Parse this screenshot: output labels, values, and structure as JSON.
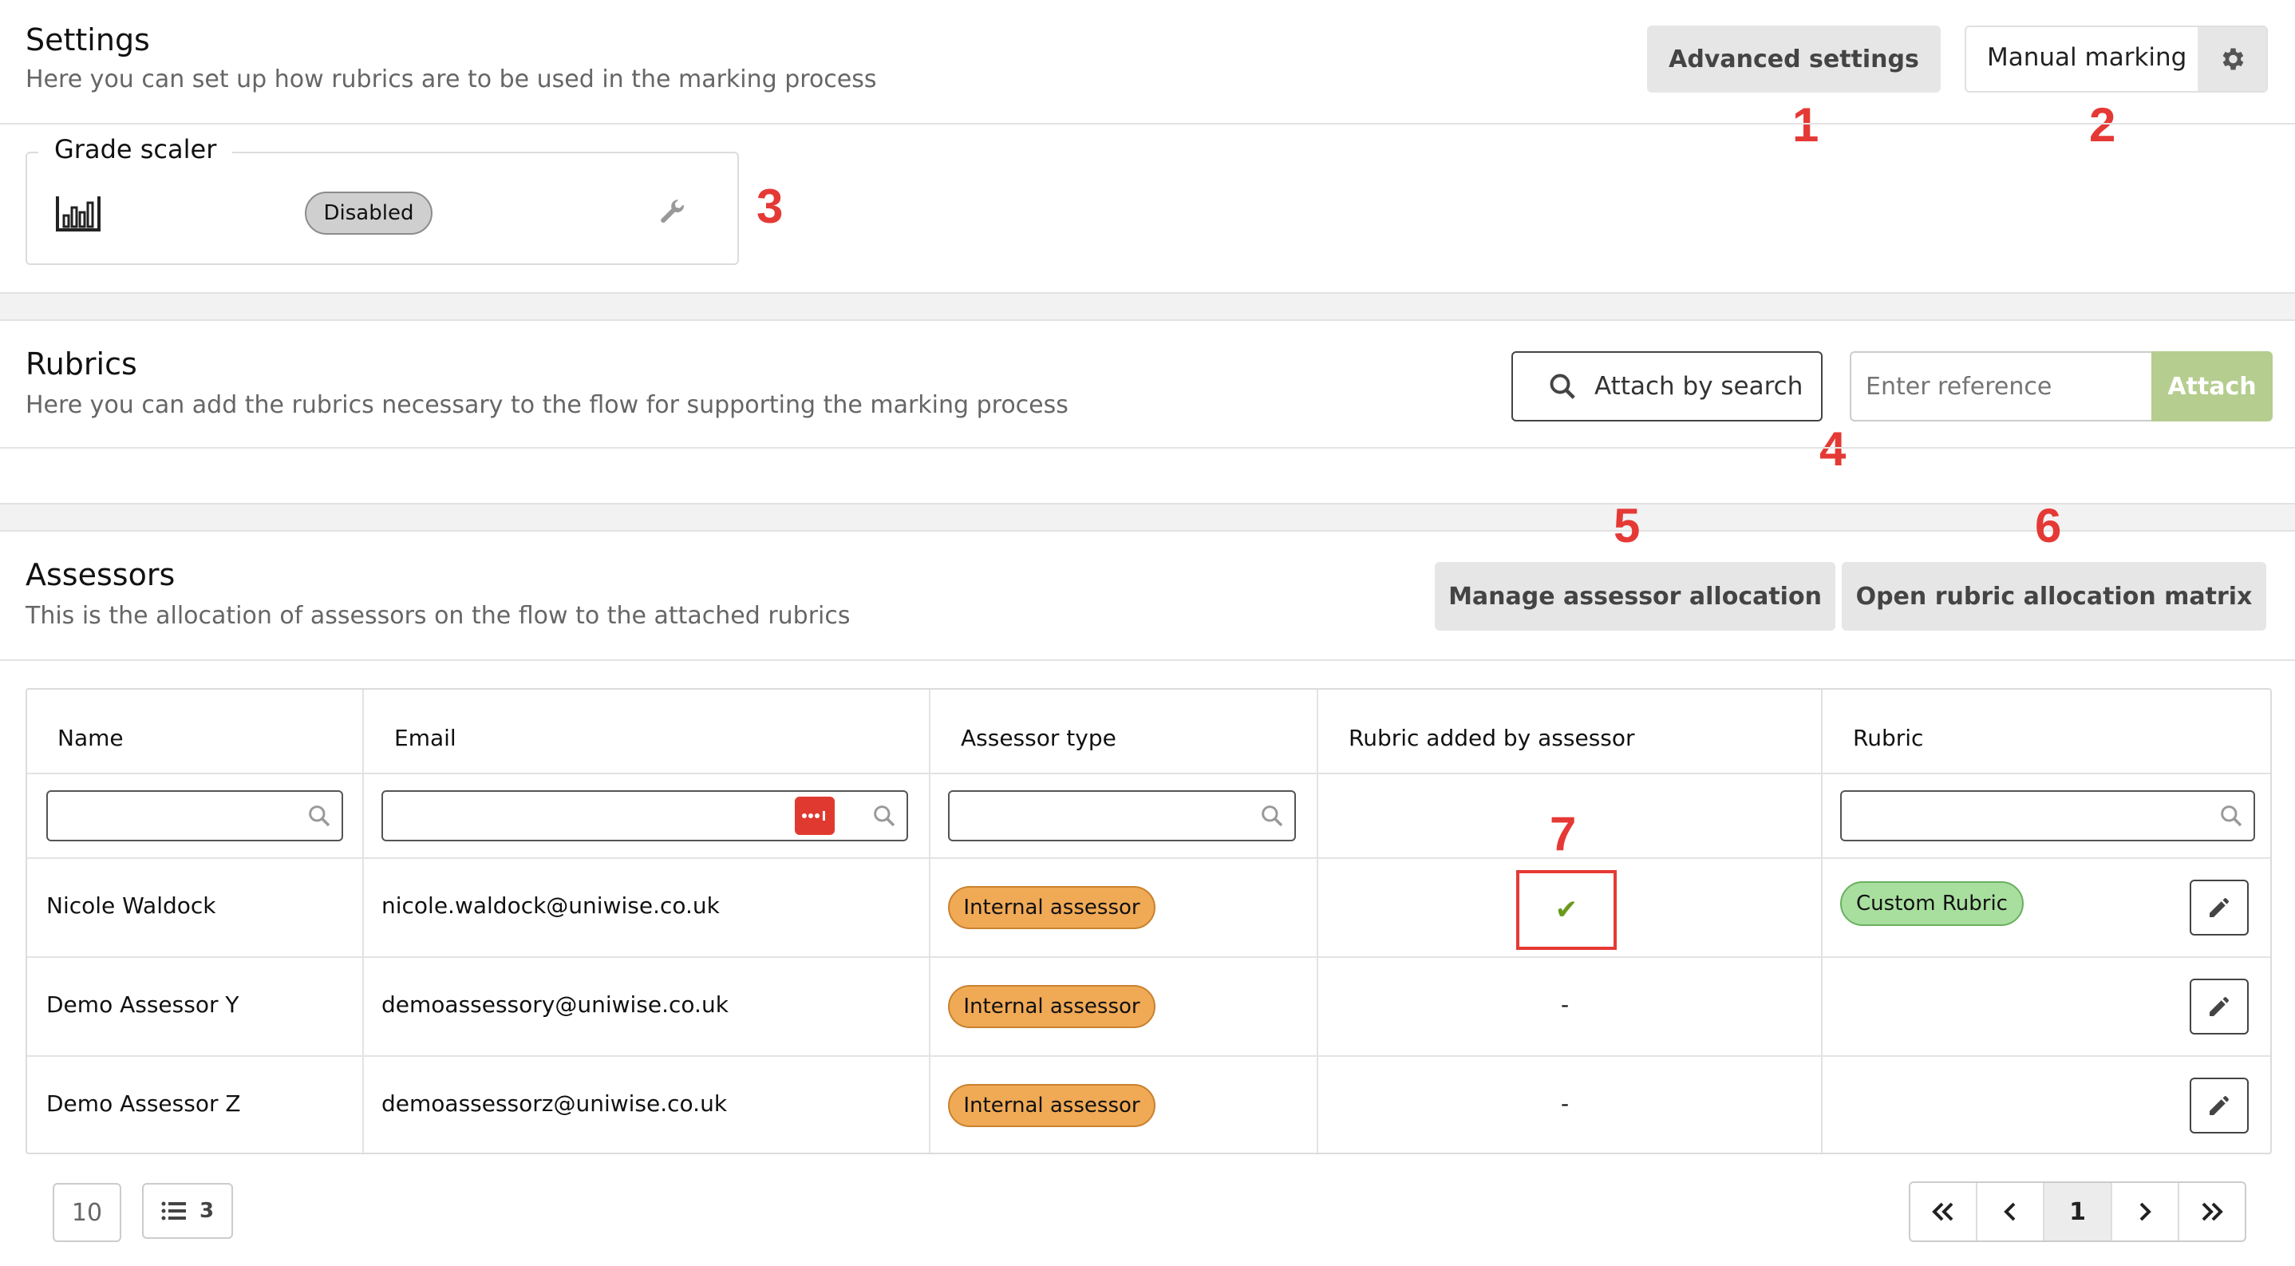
{
  "settings": {
    "title": "Settings",
    "subtitle": "Here you can set up how rubrics are to be used in the marking process",
    "advanced_settings_label": "Advanced settings",
    "manual_marking_label": "Manual marking",
    "grade_scaler": {
      "legend": "Grade scaler",
      "status": "Disabled"
    }
  },
  "rubrics": {
    "title": "Rubrics",
    "subtitle": "Here you can add the rubrics necessary to the flow for supporting the marking process",
    "attach_by_search_label": "Attach by search",
    "reference_placeholder": "Enter reference",
    "attach_label": "Attach"
  },
  "assessors": {
    "title": "Assessors",
    "subtitle": "This is the allocation of assessors on the flow to the attached rubrics",
    "manage_allocation_label": "Manage assessor allocation",
    "open_matrix_label": "Open rubric allocation matrix",
    "columns": [
      "Name",
      "Email",
      "Assessor type",
      "Rubric added by assessor",
      "Rubric"
    ],
    "rows": [
      {
        "name": "Nicole Waldock",
        "email": "nicole.waldock@uniwise.co.uk",
        "type": "Internal assessor",
        "rubric_added": "✔",
        "rubric": "Custom Rubric"
      },
      {
        "name": "Demo Assessor Y",
        "email": "demoassessory@uniwise.co.uk",
        "type": "Internal assessor",
        "rubric_added": "-",
        "rubric": ""
      },
      {
        "name": "Demo Assessor Z",
        "email": "demoassessorz@uniwise.co.uk",
        "type": "Internal assessor",
        "rubric_added": "-",
        "rubric": ""
      }
    ]
  },
  "pagination": {
    "page_size": "10",
    "row_count": "3",
    "current_page": "1"
  },
  "markers": [
    "1",
    "2",
    "3",
    "4",
    "5",
    "6",
    "7"
  ],
  "colors": {
    "marker_red": "#e53935",
    "attach_green": "#b5cd8f",
    "badge_orange": "#f0a955",
    "badge_green": "#a8df9f"
  }
}
